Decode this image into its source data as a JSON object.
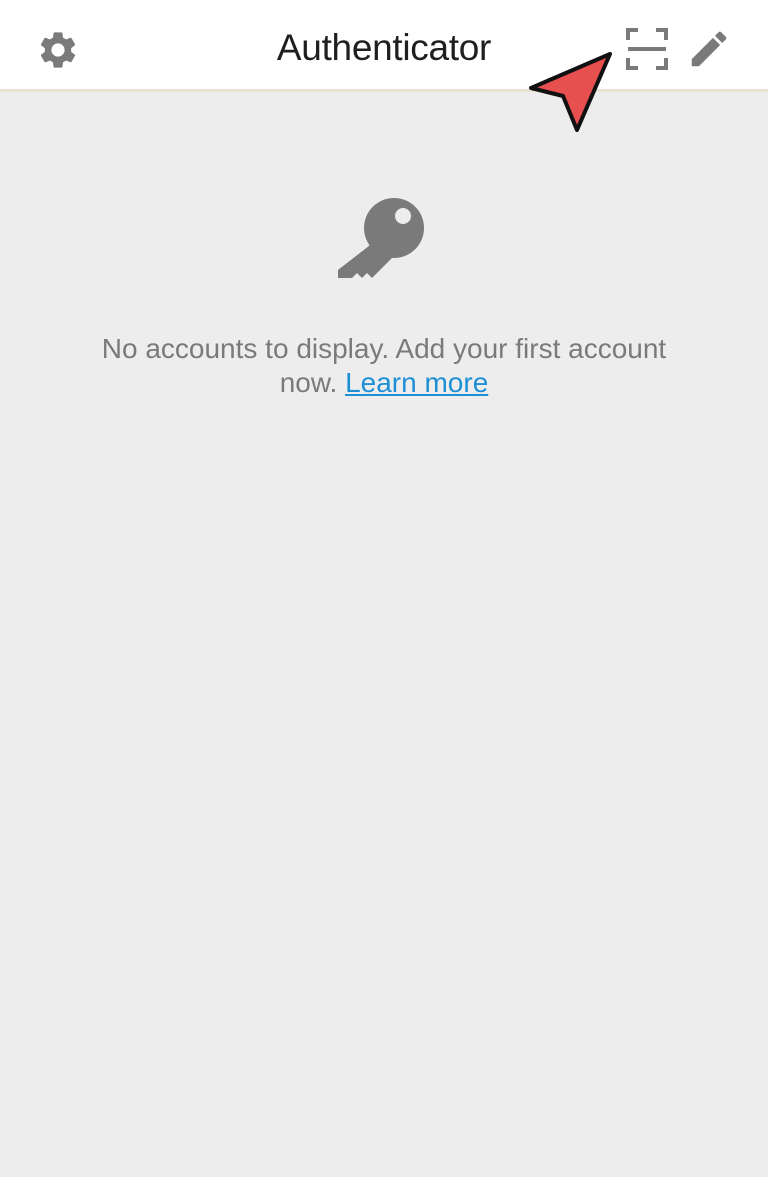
{
  "header": {
    "title": "Authenticator",
    "left_icon": "gear-icon",
    "right_icons": [
      "scan-qr-icon",
      "pencil-icon"
    ]
  },
  "empty_state": {
    "icon": "key-icon",
    "message": "No accounts to display. Add your first account now.",
    "link_label": "Learn more"
  },
  "annotation": {
    "icon": "pointer-arrow-icon",
    "color": "#e85050"
  },
  "colors": {
    "header_background": "#ffffff",
    "content_background": "#ededed",
    "icon_gray": "#7a7a7a",
    "link_blue": "#1d8fd4",
    "title_text": "#1f1f1f"
  }
}
